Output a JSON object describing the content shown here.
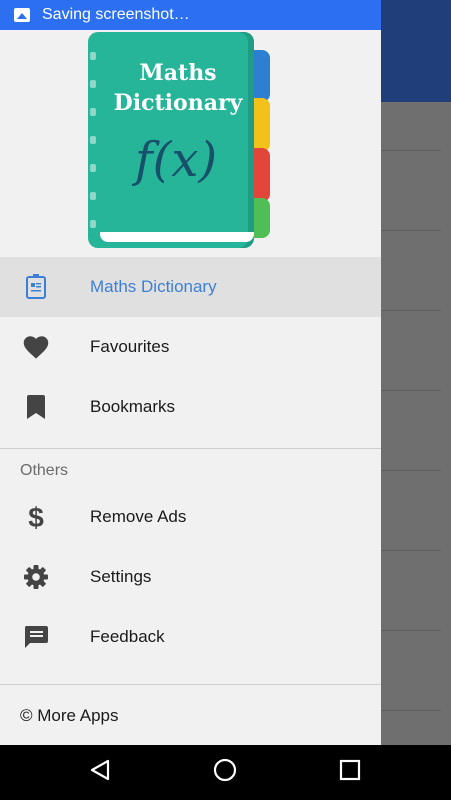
{
  "status_bar": {
    "notification": "Saving screenshot…"
  },
  "header": {
    "book_title_line1": "Maths",
    "book_title_line2": "Dictionary",
    "book_symbol": "f(x)"
  },
  "menu": {
    "items": [
      {
        "label": "Maths Dictionary",
        "icon": "book-icon",
        "active": true
      },
      {
        "label": "Favourites",
        "icon": "heart-icon"
      },
      {
        "label": "Bookmarks",
        "icon": "bookmark-icon"
      }
    ],
    "section_title": "Others",
    "others": [
      {
        "label": "Remove Ads",
        "icon": "dollar-icon"
      },
      {
        "label": "Settings",
        "icon": "gear-icon"
      },
      {
        "label": "Feedback",
        "icon": "feedback-icon"
      }
    ],
    "footer": "© More Apps"
  },
  "nav": {
    "back": "back-icon",
    "home": "home-icon",
    "recents": "recents-icon"
  },
  "colors": {
    "accent": "#3d7fd6",
    "status_notif": "#2c6ff0",
    "toolbar": "#1f3e7a",
    "book": "#26b598"
  }
}
